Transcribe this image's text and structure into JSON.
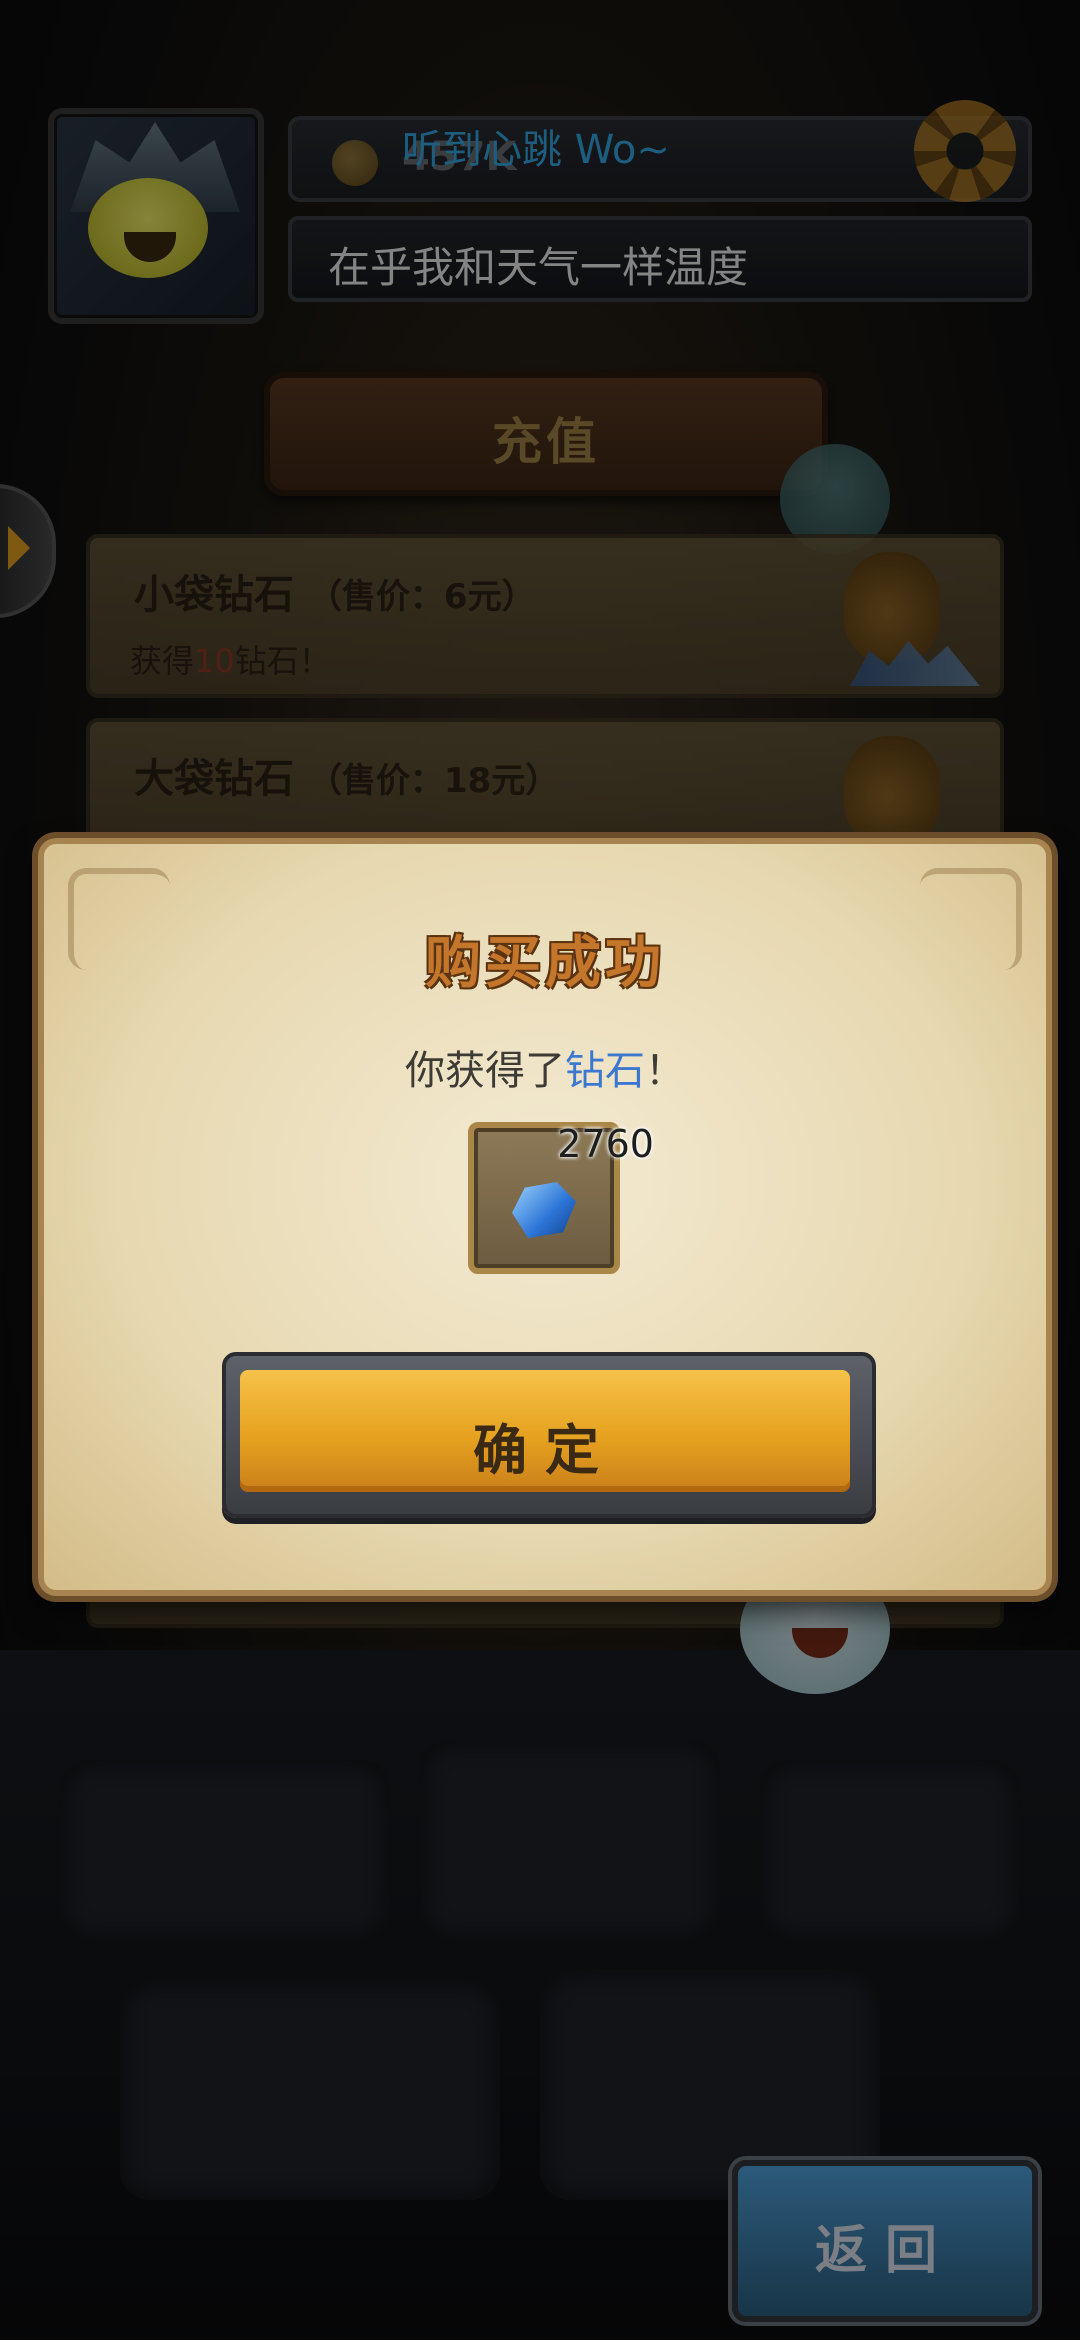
{
  "profile": {
    "coins": "457K",
    "nickname": "听到心跳 Wo~",
    "signature": "在乎我和天气一样温度"
  },
  "shop": {
    "title": "充值",
    "items": [
      {
        "name": "小袋钻石",
        "price": "（售价：6元）",
        "desc_prefix": "获得",
        "desc_amount": "10",
        "desc_suffix": "钻石！"
      },
      {
        "name": "大袋钻石",
        "price": "（售价：18元）",
        "desc_prefix": "",
        "desc_amount": "",
        "desc_suffix": ""
      }
    ]
  },
  "modal": {
    "title": "购买成功",
    "message_prefix": "你获得了",
    "message_item": "钻石",
    "message_suffix": "！",
    "reward_count": "2760",
    "reward_icon": "diamond-icon",
    "confirm_label": "确定"
  },
  "footer": {
    "back_label": "返回"
  },
  "colors": {
    "accent_orange": "#e6a21f",
    "highlight_blue": "#3c78d0",
    "nickname_blue": "#36a9e6"
  }
}
